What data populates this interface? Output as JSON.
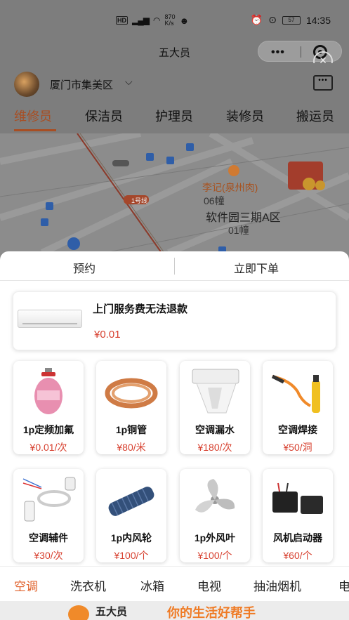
{
  "status_bar": {
    "speed_value": "870",
    "speed_unit": "K/s",
    "time": "14:35",
    "battery": "57"
  },
  "header": {
    "app_title": "五大员"
  },
  "location": {
    "district": "厦门市集美区"
  },
  "categories_top": [
    "维修员",
    "保洁员",
    "护理员",
    "装修员",
    "搬运员"
  ],
  "map": {
    "poi_name": "李记(泉州肉)",
    "building_1": "06幢",
    "area": "软件园三期A区",
    "building_2": "01幢",
    "line_label": "1号线"
  },
  "order_tabs": {
    "reserve": "预约",
    "order_now": "立即下单"
  },
  "featured": {
    "name": "上门服务费无法退款",
    "price": "¥0.01"
  },
  "products": [
    {
      "name": "1p定频加氟",
      "price": "¥0.01/次",
      "icon": "refrigerant-tank-icon"
    },
    {
      "name": "1p铜管",
      "price": "¥80/米",
      "icon": "copper-pipe-icon"
    },
    {
      "name": "空调漏水",
      "price": "¥180/次",
      "icon": "ac-leak-icon"
    },
    {
      "name": "空调焊接",
      "price": "¥50/洞",
      "icon": "welding-torch-icon"
    },
    {
      "name": "空调辅件",
      "price": "¥30/次",
      "icon": "ac-accessories-icon"
    },
    {
      "name": "1p内风轮",
      "price": "¥100/个",
      "icon": "blower-wheel-icon"
    },
    {
      "name": "1p外风叶",
      "price": "¥100/个",
      "icon": "fan-blade-icon"
    },
    {
      "name": "风机启动器",
      "price": "¥60/个",
      "icon": "capacitor-icon"
    }
  ],
  "service_categories": [
    "空调",
    "洗衣机",
    "冰箱",
    "电视",
    "抽油烟机",
    "电"
  ],
  "banner": {
    "logo_text": "五大员",
    "slogan": "你的生活好帮手"
  },
  "colors": {
    "accent": "#e0612a",
    "price": "#d7402f",
    "active_tab": "#a84e23"
  }
}
